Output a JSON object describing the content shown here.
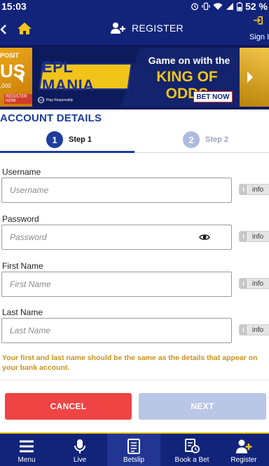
{
  "status_bar": {
    "time": "15:03",
    "battery": "52 %"
  },
  "header": {
    "title": "REGISTER",
    "sign_in_label": "Sign In"
  },
  "banner": {
    "left_peek": {
      "line1": "POSIT",
      "line2": "US",
      "line3": ",000",
      "cta": "REGISTER NOW"
    },
    "logo_text": "EPL MANIA",
    "headline": "Game on with the",
    "highlight": "KING OF ODDS",
    "cta": "BET NOW",
    "age_badge": "18+",
    "responsible": "Play Responsibly"
  },
  "account": {
    "title": "ACCOUNT DETAILS",
    "steps": [
      {
        "number": "1",
        "label": "Step 1"
      },
      {
        "number": "2",
        "label": "Step 2"
      }
    ]
  },
  "form": {
    "fields": [
      {
        "label": "Username",
        "placeholder": "Username",
        "info": "info"
      },
      {
        "label": "Password",
        "placeholder": "Password",
        "info": "info"
      },
      {
        "label": "First Name",
        "placeholder": "First Name",
        "info": "info"
      },
      {
        "label": "Last Name",
        "placeholder": "Last Name",
        "info": "info"
      }
    ],
    "note": "Your first and last name should be the same as the details that appear on your bank account.",
    "cancel_label": "CANCEL",
    "next_label": "NEXT"
  },
  "bottom_nav": {
    "items": [
      {
        "label": "Menu",
        "icon": "hamburger-icon"
      },
      {
        "label": "Live",
        "icon": "microphone-icon"
      },
      {
        "label": "Betslip",
        "icon": "betslip-icon"
      },
      {
        "label": "Book a Bet",
        "icon": "book-clock-icon"
      },
      {
        "label": "Register",
        "icon": "add-user-icon"
      }
    ],
    "active_index": 2
  },
  "colors": {
    "primary": "#12247a",
    "accent": "#f0c419",
    "step_active": "#1e3c9e",
    "cancel": "#ef4444",
    "next_disabled": "#b9c6e6",
    "note": "#c9921c"
  }
}
